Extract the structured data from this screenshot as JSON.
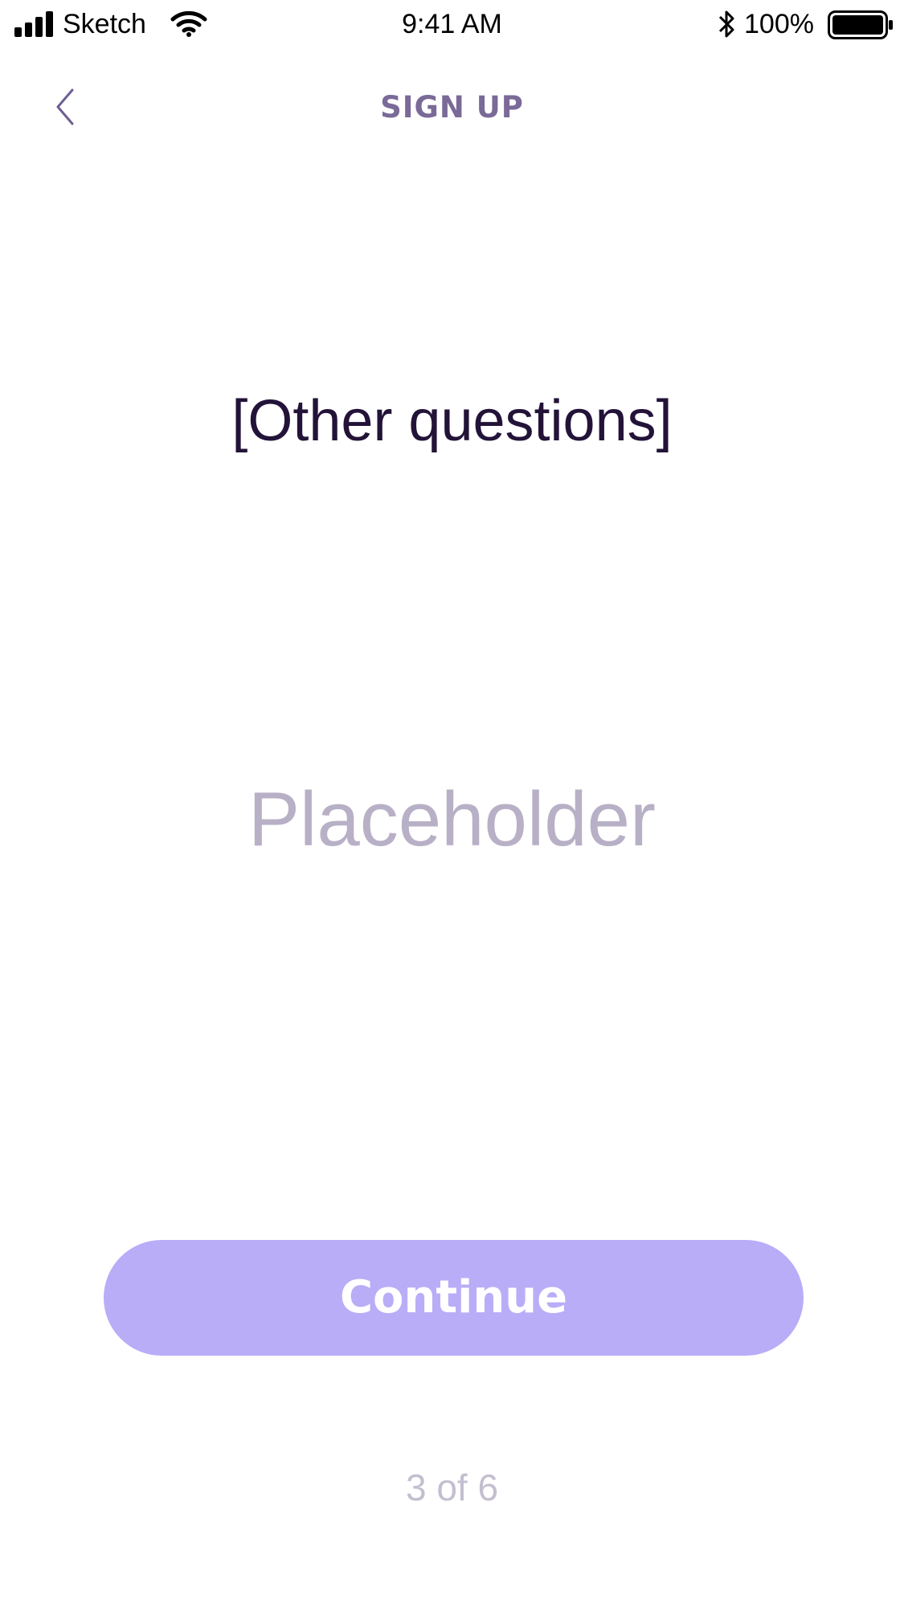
{
  "status_bar": {
    "carrier": "Sketch",
    "time": "9:41 AM",
    "battery_percent": "100%",
    "icons": [
      "signal-icon",
      "wifi-icon",
      "bluetooth-icon",
      "battery-icon"
    ]
  },
  "nav": {
    "back_icon": "chevron-left-icon",
    "title": "SIGN UP"
  },
  "main": {
    "question": "[Other questions]",
    "answer_placeholder": "Placeholder",
    "answer_value": "",
    "continue_label": "Continue",
    "step_indicator": "3 of 6"
  },
  "colors": {
    "title": "#7a6a98",
    "question": "#231338",
    "placeholder": "#b8b0c6",
    "button": "#b9adf8",
    "button_text": "#ffffff",
    "step_text": "#c4bed0"
  }
}
